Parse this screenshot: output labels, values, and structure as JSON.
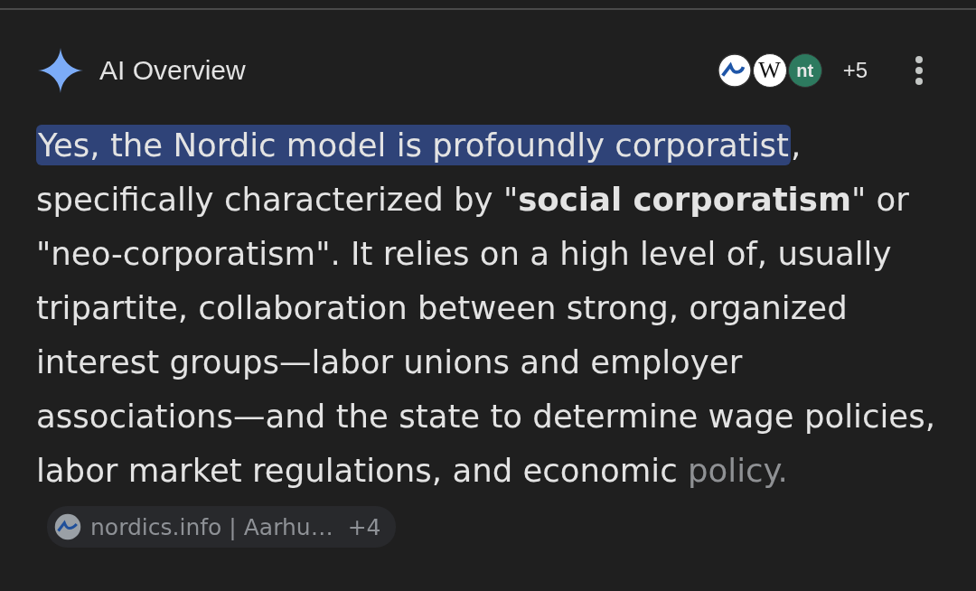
{
  "header": {
    "title": "AI Overview",
    "sources": [
      {
        "kind": "wave"
      },
      {
        "kind": "letter",
        "text": "W"
      },
      {
        "kind": "letter",
        "text": "nt"
      }
    ],
    "source_count": "+5"
  },
  "answer": {
    "segments": [
      {
        "kind": "highlight",
        "text": "Yes, the Nordic model is profoundly corporatist"
      },
      {
        "kind": "plain",
        "text": ", specifically characterized by \"**social corporatism**\" or \"neo-corporatism\". It relies on a high level of, usually tripartite, collaboration between strong, organized interest groups—labor unions and employer associations—and the state to determine wage policies, labor market regulations, and economic "
      },
      {
        "kind": "faded",
        "text": "policy."
      }
    ],
    "citation": {
      "label": "nordics.info | Aarhu…",
      "count": "+4"
    }
  }
}
